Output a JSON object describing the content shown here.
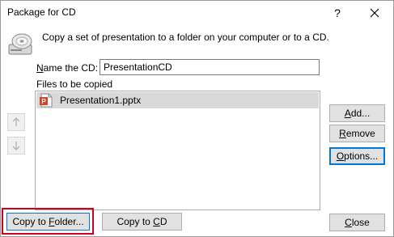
{
  "window": {
    "title": "Package for CD",
    "help_label": "?",
    "close_icon": "close-icon"
  },
  "header": {
    "icon": "cd-drive-icon",
    "description": "Copy a set of presentation to a folder on your computer or to a CD."
  },
  "name_field": {
    "label_prefix": "",
    "label_access": "N",
    "label_rest": "ame the CD:",
    "value": "PresentationCD"
  },
  "files": {
    "label": "Files to be copied",
    "items": [
      {
        "name": "Presentation1.pptx",
        "icon": "powerpoint-file-icon",
        "selected": true
      }
    ]
  },
  "reorder": {
    "up_icon": "arrow-up-icon",
    "down_icon": "arrow-down-icon"
  },
  "buttons": {
    "add": {
      "prefix": "",
      "access": "A",
      "rest": "dd..."
    },
    "remove": {
      "prefix": "",
      "access": "R",
      "rest": "emove"
    },
    "options": {
      "prefix": "",
      "access": "O",
      "rest": "ptions..."
    },
    "copy_to_folder": {
      "prefix": "Copy to ",
      "access": "F",
      "rest": "older..."
    },
    "copy_to_cd": {
      "prefix": "Copy to ",
      "access": "C",
      "rest": "D"
    },
    "close": {
      "prefix": "",
      "access": "C",
      "rest": "lose"
    }
  },
  "colors": {
    "focus_accent": "#0078d7",
    "highlight_box": "#d0021b",
    "selected_row": "#d9d9d9",
    "button_face": "#e1e1e1",
    "powerpoint_orange": "#d24726"
  }
}
